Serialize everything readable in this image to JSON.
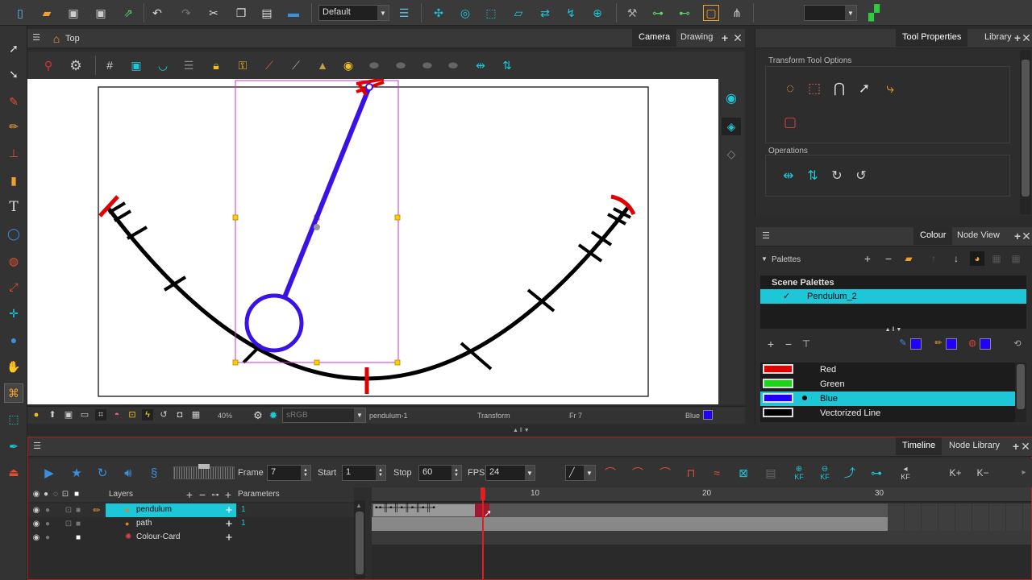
{
  "toolbar": {
    "workspace": "Default"
  },
  "camera_view": {
    "breadcrumb": "Top",
    "tabs": [
      "Camera",
      "Drawing"
    ],
    "status": {
      "zoom": "40%",
      "color_space": "sRGB",
      "drawing": "pendulum-1",
      "tool": "Transform",
      "frame": "Fr 7",
      "color": "Blue"
    }
  },
  "tool_properties": {
    "tabs": [
      "Tool Properties",
      "Library"
    ],
    "section_options": "Transform Tool Options",
    "section_operations": "Operations"
  },
  "colour_panel": {
    "tabs": [
      "Colour",
      "Node View"
    ],
    "palettes_label": "Palettes",
    "scene_palettes": "Scene Palettes",
    "palette_check": "✓",
    "palette_name": "Pendulum_2",
    "swatches": [
      {
        "name": "Red",
        "color": "#e00000"
      },
      {
        "name": "Green",
        "color": "#1ed418"
      },
      {
        "name": "Blue",
        "color": "#1f00ff"
      },
      {
        "name": "Vectorized Line",
        "color": "#000000"
      }
    ],
    "selected_swatch": "Blue"
  },
  "timeline": {
    "tabs": [
      "Timeline",
      "Node Library"
    ],
    "frame_label": "Frame",
    "frame_value": "7",
    "start_label": "Start",
    "start_value": "1",
    "stop_label": "Stop",
    "stop_value": "60",
    "fps_label": "FPS",
    "fps_value": "24",
    "layers_header": "Layers",
    "params_header": "Parameters",
    "ruler": [
      "10",
      "20",
      "30"
    ],
    "layers": [
      {
        "name": "pendulum",
        "param": "1"
      },
      {
        "name": "path",
        "param": "1"
      },
      {
        "name": "Colour-Card",
        "param": ""
      }
    ],
    "current_frame": 7
  },
  "colors": {
    "accent": "#1ec7d8",
    "pendulum": "#3a12e6",
    "marker_red": "#e00000"
  }
}
